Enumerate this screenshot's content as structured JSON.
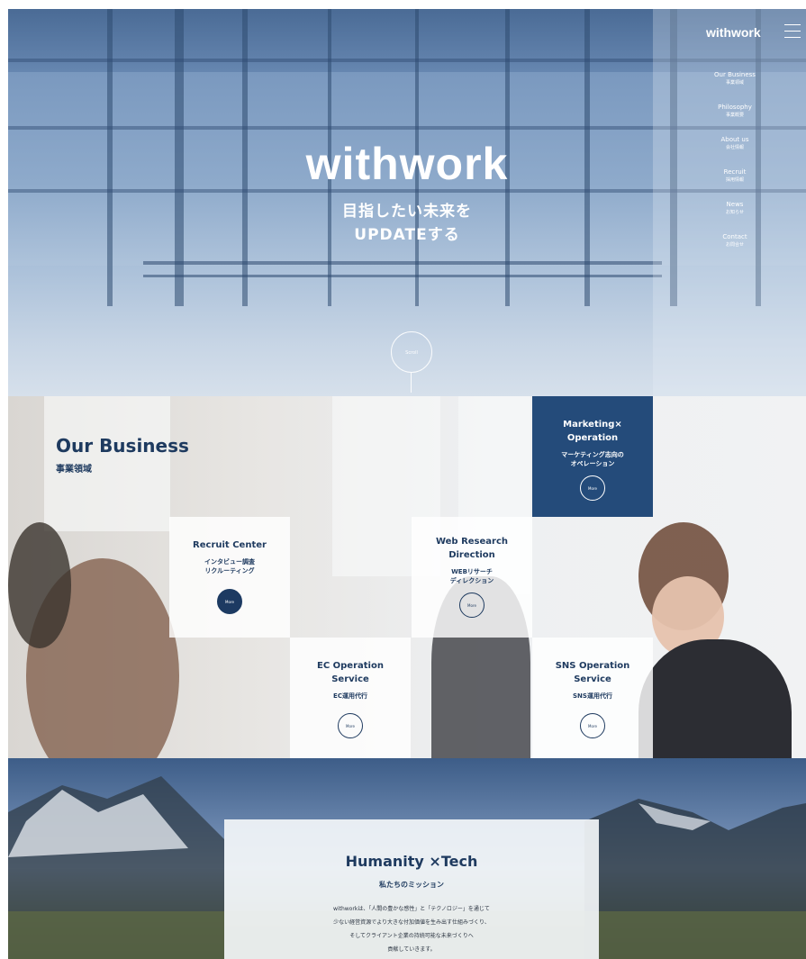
{
  "header": {
    "brand": "withwork",
    "menu_icon": "hamburger-menu-icon"
  },
  "hero": {
    "logo": "withwork",
    "tagline_line1": "目指したい未来を",
    "tagline_line2": "UPDATEする",
    "scroll_label": "Scroll"
  },
  "nav": [
    {
      "en": "Our Business",
      "jp": "事業領域"
    },
    {
      "en": "Philosophy",
      "jp": "事業概要"
    },
    {
      "en": "About us",
      "jp": "会社情報"
    },
    {
      "en": "Recruit",
      "jp": "採用情報"
    },
    {
      "en": "News",
      "jp": "お知らせ"
    },
    {
      "en": "Contact",
      "jp": "お問合せ"
    }
  ],
  "business": {
    "title": "Our Business",
    "subtitle": "事業領域",
    "more_label": "More",
    "tiles": [
      {
        "title": "Marketing×\nOperation",
        "jp": "マーケティング志向の\nオペレーション"
      },
      {
        "title": "Recruit Center",
        "jp": "インタビュー調査\nリクルーティング"
      },
      {
        "title": "Web Research\nDirection",
        "jp": "WEBリサーチ\nディレクション"
      },
      {
        "title": "EC Operation\nService",
        "jp": "EC運用代行"
      },
      {
        "title": "SNS Operation\nService",
        "jp": "SNS運用代行"
      }
    ]
  },
  "mission": {
    "title": "Humanity ×Tech",
    "subtitle": "私たちのミッション",
    "body": [
      "withworkは、「人間の豊かな感性」と「テクノロジー」を通じて",
      "少ない経営資源でより大きな付加価値を生み出す仕組みづくり、",
      "そしてクライアント企業の持続可能な未来づくりへ",
      "貢献していきます。"
    ]
  },
  "colors": {
    "navy": "#1e3a5f",
    "tile_dark": "#244b7a",
    "hero_blue": "#8eaacb"
  }
}
